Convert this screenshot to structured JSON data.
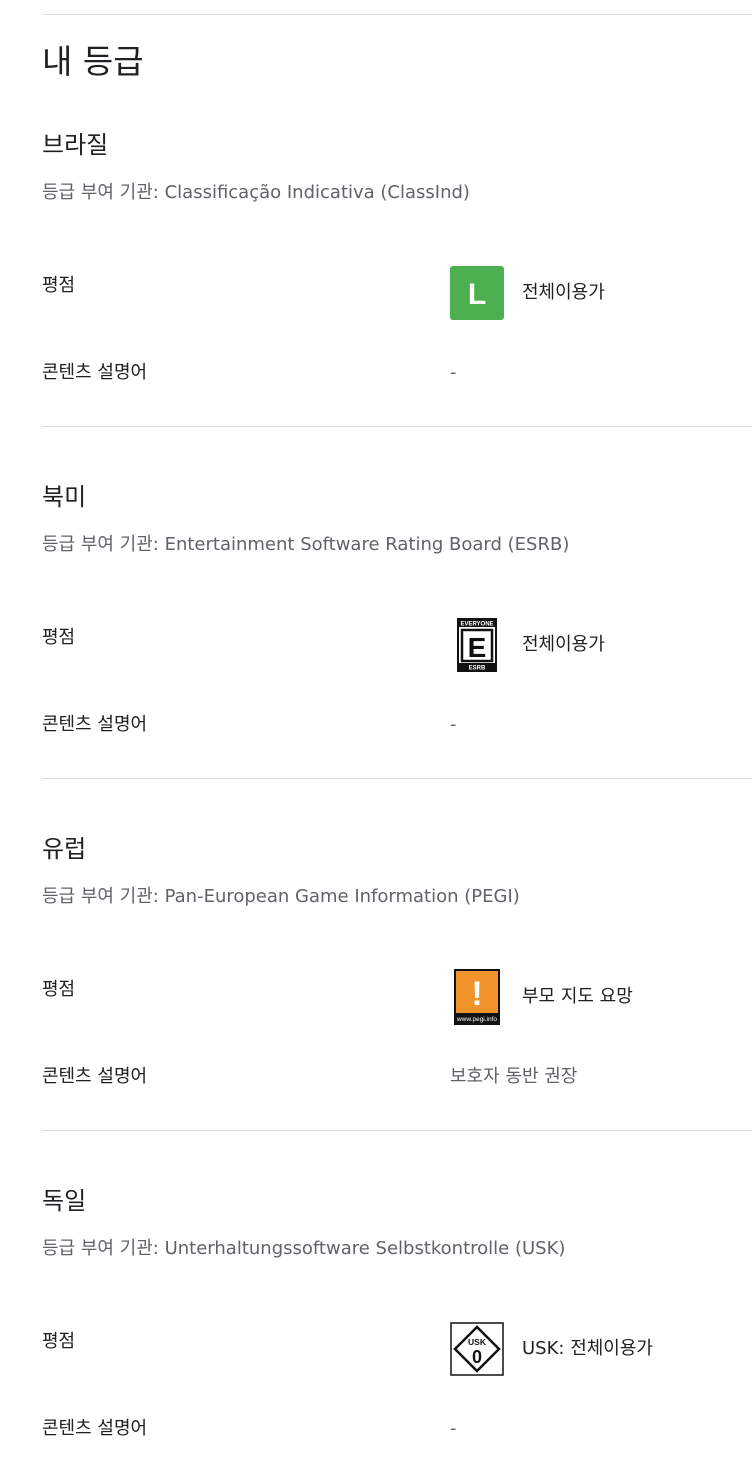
{
  "page": {
    "title": "내 등급"
  },
  "regions": [
    {
      "name": "브라질",
      "authority": "등급 부여 기관: Classificação Indicativa (ClassInd)",
      "rating_label": "평점",
      "rating_icon": "classind-l-icon",
      "rating_icon_text": "L",
      "rating_value": "전체이용가",
      "descriptors_label": "콘텐츠 설명어",
      "descriptors_value": "-",
      "color": "#4caf50"
    },
    {
      "name": "북미",
      "authority": "등급 부여 기관: Entertainment Software Rating Board (ESRB)",
      "rating_label": "평점",
      "rating_icon": "esrb-everyone-icon",
      "rating_icon_text": "E",
      "rating_value": "전체이용가",
      "descriptors_label": "콘텐츠 설명어",
      "descriptors_value": "-"
    },
    {
      "name": "유럽",
      "authority": "등급 부여 기관: Pan-European Game Information (PEGI)",
      "rating_label": "평점",
      "rating_icon": "pegi-parental-guidance-icon",
      "rating_icon_text": "!",
      "rating_value": "부모 지도 요망",
      "descriptors_label": "콘텐츠 설명어",
      "descriptors_value": "보호자 동반 권장",
      "color": "#f0932b"
    },
    {
      "name": "독일",
      "authority": "등급 부여 기관: Unterhaltungssoftware Selbstkontrolle (USK)",
      "rating_label": "평점",
      "rating_icon": "usk-0-icon",
      "rating_icon_text": "0",
      "rating_value": "USK: 전체이용가",
      "descriptors_label": "콘텐츠 설명어",
      "descriptors_value": "-"
    }
  ],
  "icon_text": {
    "esrb_top": "EVERYONE",
    "esrb_bottom": "ESRB",
    "pegi_site": "www.pegi.info",
    "usk_label": "USK"
  }
}
